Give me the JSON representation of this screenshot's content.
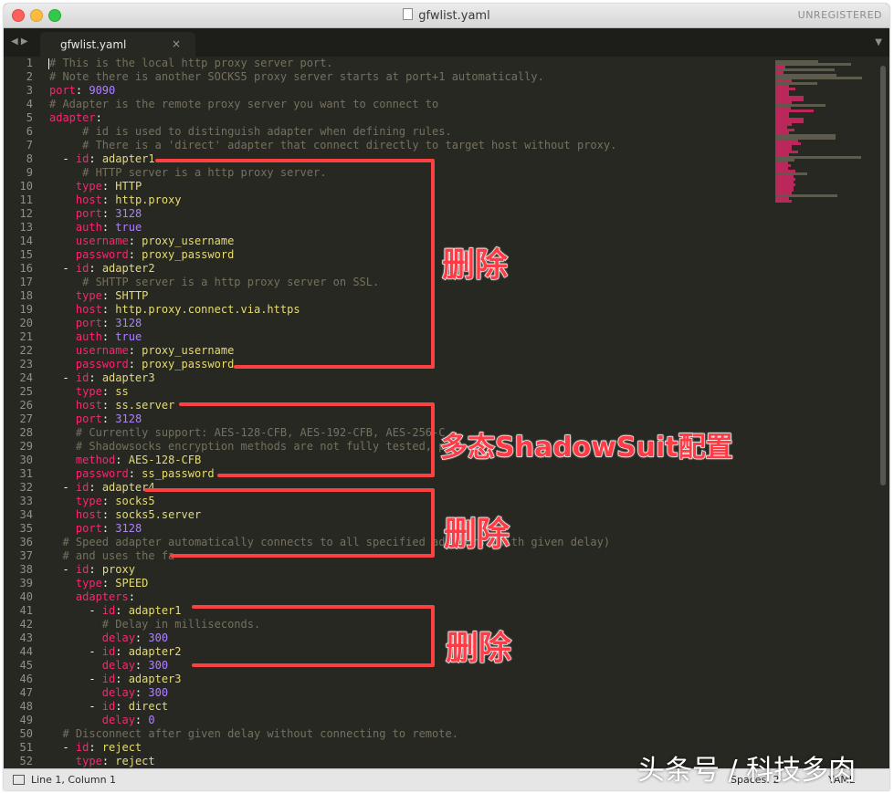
{
  "window": {
    "title": "gfwlist.yaml",
    "registration": "UNREGISTERED"
  },
  "tab": {
    "label": "gfwlist.yaml",
    "close": "×"
  },
  "colors": {
    "background": "#272822",
    "comment": "#75715e",
    "key": "#f92672",
    "string": "#e6db74",
    "number": "#ae81ff",
    "annotation": "#ff3b45"
  },
  "code_lines": [
    [
      [
        "c",
        "# This is the local http proxy server port."
      ]
    ],
    [
      [
        "c",
        "# Note there is another SOCKS5 proxy server starts at port+1 automatically."
      ]
    ],
    [
      [
        "k",
        "port"
      ],
      [
        "t",
        ": "
      ],
      [
        "n",
        "9090"
      ]
    ],
    [
      [
        "c",
        "# Adapter is the remote proxy server you want to connect to"
      ]
    ],
    [
      [
        "k",
        "adapter"
      ],
      [
        "t",
        ":"
      ]
    ],
    [
      [
        "t",
        "     "
      ],
      [
        "c",
        "# id is used to distinguish adapter when defining rules."
      ]
    ],
    [
      [
        "t",
        "     "
      ],
      [
        "c",
        "# There is a 'direct' adapter that connect directly to target host without proxy."
      ]
    ],
    [
      [
        "t",
        "  - "
      ],
      [
        "k",
        "id"
      ],
      [
        "t",
        ": "
      ],
      [
        "s",
        "adapter1"
      ]
    ],
    [
      [
        "t",
        "     "
      ],
      [
        "c",
        "# HTTP server is a http proxy server."
      ]
    ],
    [
      [
        "t",
        "    "
      ],
      [
        "k",
        "type"
      ],
      [
        "t",
        ": "
      ],
      [
        "s",
        "HTTP"
      ]
    ],
    [
      [
        "t",
        "    "
      ],
      [
        "k",
        "host"
      ],
      [
        "t",
        ": "
      ],
      [
        "s",
        "http.proxy"
      ]
    ],
    [
      [
        "t",
        "    "
      ],
      [
        "k",
        "port"
      ],
      [
        "t",
        ": "
      ],
      [
        "n",
        "3128"
      ]
    ],
    [
      [
        "t",
        "    "
      ],
      [
        "k",
        "auth"
      ],
      [
        "t",
        ": "
      ],
      [
        "n",
        "true"
      ]
    ],
    [
      [
        "t",
        "    "
      ],
      [
        "k",
        "username"
      ],
      [
        "t",
        ": "
      ],
      [
        "s",
        "proxy_username"
      ]
    ],
    [
      [
        "t",
        "    "
      ],
      [
        "k",
        "password"
      ],
      [
        "t",
        ": "
      ],
      [
        "s",
        "proxy_password"
      ]
    ],
    [
      [
        "t",
        "  - "
      ],
      [
        "k",
        "id"
      ],
      [
        "t",
        ": "
      ],
      [
        "s",
        "adapter2"
      ]
    ],
    [
      [
        "t",
        "     "
      ],
      [
        "c",
        "# SHTTP server is a http proxy server on SSL."
      ]
    ],
    [
      [
        "t",
        "    "
      ],
      [
        "k",
        "type"
      ],
      [
        "t",
        ": "
      ],
      [
        "s",
        "SHTTP"
      ]
    ],
    [
      [
        "t",
        "    "
      ],
      [
        "k",
        "host"
      ],
      [
        "t",
        ": "
      ],
      [
        "s",
        "http.proxy.connect.via.https"
      ]
    ],
    [
      [
        "t",
        "    "
      ],
      [
        "k",
        "port"
      ],
      [
        "t",
        ": "
      ],
      [
        "n",
        "3128"
      ]
    ],
    [
      [
        "t",
        "    "
      ],
      [
        "k",
        "auth"
      ],
      [
        "t",
        ": "
      ],
      [
        "n",
        "true"
      ]
    ],
    [
      [
        "t",
        "    "
      ],
      [
        "k",
        "username"
      ],
      [
        "t",
        ": "
      ],
      [
        "s",
        "proxy_username"
      ]
    ],
    [
      [
        "t",
        "    "
      ],
      [
        "k",
        "password"
      ],
      [
        "t",
        ": "
      ],
      [
        "s",
        "proxy_password"
      ]
    ],
    [
      [
        "t",
        "  - "
      ],
      [
        "k",
        "id"
      ],
      [
        "t",
        ": "
      ],
      [
        "s",
        "adapter3"
      ]
    ],
    [
      [
        "t",
        "    "
      ],
      [
        "k",
        "type"
      ],
      [
        "t",
        ": "
      ],
      [
        "s",
        "ss"
      ]
    ],
    [
      [
        "t",
        "    "
      ],
      [
        "k",
        "host"
      ],
      [
        "t",
        ": "
      ],
      [
        "s",
        "ss.server"
      ]
    ],
    [
      [
        "t",
        "    "
      ],
      [
        "k",
        "port"
      ],
      [
        "t",
        ": "
      ],
      [
        "n",
        "3128"
      ]
    ],
    [
      [
        "t",
        "    "
      ],
      [
        "c",
        "# Currently support: AES-128-CFB, AES-192-CFB, AES-256-C"
      ]
    ],
    [
      [
        "t",
        "    "
      ],
      [
        "c",
        "# Shadowsocks encryption methods are not fully tested, p"
      ]
    ],
    [
      [
        "t",
        "    "
      ],
      [
        "k",
        "method"
      ],
      [
        "t",
        ": "
      ],
      [
        "s",
        "AES-128-CFB"
      ]
    ],
    [
      [
        "t",
        "    "
      ],
      [
        "k",
        "password"
      ],
      [
        "t",
        ": "
      ],
      [
        "s",
        "ss_password"
      ]
    ],
    [
      [
        "t",
        "  - "
      ],
      [
        "k",
        "id"
      ],
      [
        "t",
        ": "
      ],
      [
        "s",
        "adapter4"
      ]
    ],
    [
      [
        "t",
        "    "
      ],
      [
        "k",
        "type"
      ],
      [
        "t",
        ": "
      ],
      [
        "s",
        "socks5"
      ]
    ],
    [
      [
        "t",
        "    "
      ],
      [
        "k",
        "host"
      ],
      [
        "t",
        ": "
      ],
      [
        "s",
        "socks5.server"
      ]
    ],
    [
      [
        "t",
        "    "
      ],
      [
        "k",
        "port"
      ],
      [
        "t",
        ": "
      ],
      [
        "n",
        "3128"
      ]
    ],
    [
      [
        "t",
        "  "
      ],
      [
        "c",
        "# Speed adapter automatically connects to all specified adapters (with given delay)"
      ]
    ],
    [
      [
        "t",
        "  "
      ],
      [
        "c",
        "# and uses the fa"
      ]
    ],
    [
      [
        "t",
        "  - "
      ],
      [
        "k",
        "id"
      ],
      [
        "t",
        ": "
      ],
      [
        "s",
        "proxy"
      ]
    ],
    [
      [
        "t",
        "    "
      ],
      [
        "k",
        "type"
      ],
      [
        "t",
        ": "
      ],
      [
        "s",
        "SPEED"
      ]
    ],
    [
      [
        "t",
        "    "
      ],
      [
        "k",
        "adapters"
      ],
      [
        "t",
        ":"
      ]
    ],
    [
      [
        "t",
        "      - "
      ],
      [
        "k",
        "id"
      ],
      [
        "t",
        ": "
      ],
      [
        "s",
        "adapter1"
      ]
    ],
    [
      [
        "t",
        "        "
      ],
      [
        "c",
        "# Delay in milliseconds."
      ]
    ],
    [
      [
        "t",
        "        "
      ],
      [
        "k",
        "delay"
      ],
      [
        "t",
        ": "
      ],
      [
        "n",
        "300"
      ]
    ],
    [
      [
        "t",
        "      - "
      ],
      [
        "k",
        "id"
      ],
      [
        "t",
        ": "
      ],
      [
        "s",
        "adapter2"
      ]
    ],
    [
      [
        "t",
        "        "
      ],
      [
        "k",
        "delay"
      ],
      [
        "t",
        ": "
      ],
      [
        "n",
        "300"
      ]
    ],
    [
      [
        "t",
        "      - "
      ],
      [
        "k",
        "id"
      ],
      [
        "t",
        ": "
      ],
      [
        "s",
        "adapter3"
      ]
    ],
    [
      [
        "t",
        "        "
      ],
      [
        "k",
        "delay"
      ],
      [
        "t",
        ": "
      ],
      [
        "n",
        "300"
      ]
    ],
    [
      [
        "t",
        "      - "
      ],
      [
        "k",
        "id"
      ],
      [
        "t",
        ": "
      ],
      [
        "s",
        "direct"
      ]
    ],
    [
      [
        "t",
        "        "
      ],
      [
        "k",
        "delay"
      ],
      [
        "t",
        ": "
      ],
      [
        "n",
        "0"
      ]
    ],
    [
      [
        "t",
        "  "
      ],
      [
        "c",
        "# Disconnect after given delay without connecting to remote."
      ]
    ],
    [
      [
        "t",
        "  - "
      ],
      [
        "k",
        "id"
      ],
      [
        "t",
        ": "
      ],
      [
        "s",
        "reject"
      ]
    ],
    [
      [
        "t",
        "    "
      ],
      [
        "k",
        "type"
      ],
      [
        "t",
        ": "
      ],
      [
        "s",
        "reject"
      ]
    ]
  ],
  "annotations": {
    "delete_1": "删除",
    "shadowsuit": "多态ShadowSuit配置",
    "delete_2": "删除",
    "delete_3": "删除"
  },
  "statusbar": {
    "position": "Line 1, Column 1",
    "spaces": "Spaces: 2",
    "syntax": "YAML"
  },
  "watermark": "头条号 / 科技多肉"
}
